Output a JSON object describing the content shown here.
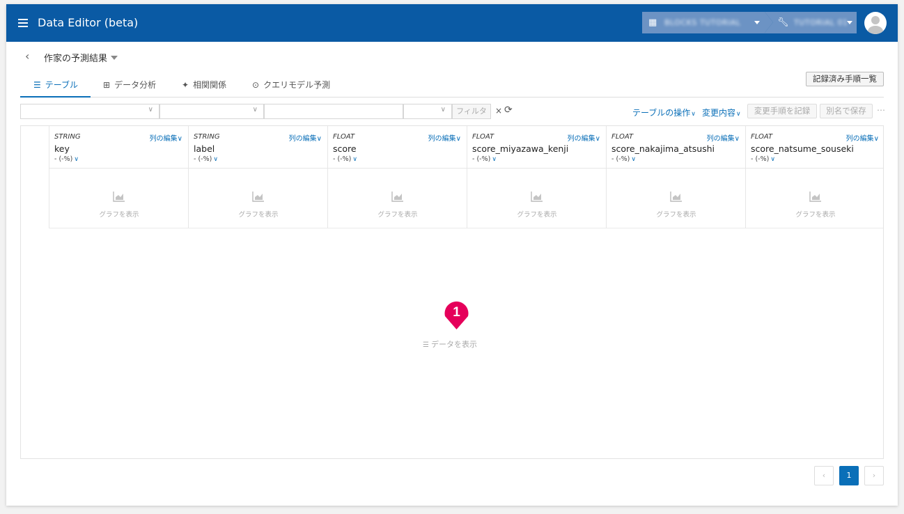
{
  "header": {
    "app_title": "Data Editor (beta)",
    "org_crumb": "BLOCKS TUTORIAL",
    "project_crumb": "TUTORIAL 01"
  },
  "page": {
    "title": "作家の予測結果"
  },
  "tabs": [
    {
      "label": "テーブル",
      "icon": "table-icon",
      "active": true
    },
    {
      "label": "データ分析",
      "icon": "plus-square-icon",
      "active": false
    },
    {
      "label": "相関関係",
      "icon": "lightbulb-icon",
      "active": false
    },
    {
      "label": "クエリモデル予測",
      "icon": "query-model-icon",
      "active": false
    }
  ],
  "toolbar": {
    "recorded_steps_label": "記録済み手順一覧",
    "filter_label": "フィルタ",
    "table_ops_label": "テーブルの操作",
    "changes_label": "変更内容",
    "record_steps_label": "変更手順を記録",
    "save_as_label": "別名で保存"
  },
  "columns": [
    {
      "type": "STRING",
      "name": "key",
      "stat": "- (-%)",
      "edit": "列の編集",
      "graph": "グラフを表示"
    },
    {
      "type": "STRING",
      "name": "label",
      "stat": "- (-%)",
      "edit": "列の編集",
      "graph": "グラフを表示"
    },
    {
      "type": "FLOAT",
      "name": "score",
      "stat": "- (-%)",
      "edit": "列の編集",
      "graph": "グラフを表示"
    },
    {
      "type": "FLOAT",
      "name": "score_miyazawa_kenji",
      "stat": "- (-%)",
      "edit": "列の編集",
      "graph": "グラフを表示"
    },
    {
      "type": "FLOAT",
      "name": "score_nakajima_atsushi",
      "stat": "- (-%)",
      "edit": "列の編集",
      "graph": "グラフを表示"
    },
    {
      "type": "FLOAT",
      "name": "score_natsume_souseki",
      "stat": "- (-%)",
      "edit": "列の編集",
      "graph": "グラフを表示"
    }
  ],
  "main": {
    "marker_number": "1",
    "show_data_label": "データを表示"
  },
  "pagination": {
    "prev": "‹",
    "current": "1",
    "next": "›"
  },
  "colors": {
    "header_bg": "#0a5aa4",
    "accent": "#0a6fb8",
    "marker": "#e5005a"
  }
}
